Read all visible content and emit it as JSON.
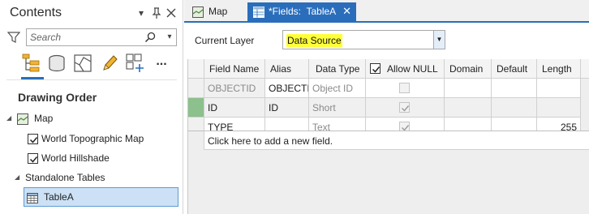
{
  "contents_pane": {
    "title": "Contents",
    "search_placeholder": "Search",
    "drawing_order_heading": "Drawing Order",
    "tree": {
      "map_label": "Map",
      "layers": [
        {
          "label": "World Topographic Map",
          "checked": true
        },
        {
          "label": "World Hillshade",
          "checked": true
        }
      ],
      "standalone_tables_label": "Standalone Tables",
      "tables": [
        {
          "label": "TableA",
          "selected": true
        }
      ]
    },
    "toolbar_more": "..."
  },
  "tabs": [
    {
      "label": "Map",
      "active": false
    },
    {
      "label": "*Fields:  TableA",
      "active": true
    }
  ],
  "fields_view": {
    "current_layer_label": "Current Layer",
    "current_layer_value": "Data Source",
    "columns": [
      "Field Name",
      "Alias",
      "Data Type",
      "Allow NULL",
      "Domain",
      "Default",
      "Length"
    ],
    "rows": [
      {
        "field_name": "OBJECTID",
        "alias": "OBJECTID",
        "data_type": "Object ID",
        "allow_null": false,
        "domain": "",
        "default": "",
        "length": ""
      },
      {
        "field_name": "ID",
        "alias": "ID",
        "data_type": "Short",
        "allow_null": true,
        "domain": "",
        "default": "",
        "length": ""
      },
      {
        "field_name": "TYPE",
        "alias": "",
        "data_type": "Text",
        "allow_null": true,
        "domain": "",
        "default": "",
        "length": "255"
      }
    ],
    "add_field_text": "Click here to add a new field."
  },
  "colors": {
    "accent": "#2a6ebb",
    "highlight": "#ffff3a",
    "row_marker": "#8cc08c",
    "selection": "#cce1f5"
  },
  "icons": {
    "pane_controls": [
      "chevron-down-icon",
      "pin-icon",
      "close-icon"
    ],
    "toolbar": [
      "list-by-drawing-order-icon",
      "list-by-source-icon",
      "list-by-selection-icon",
      "list-by-editing-icon",
      "list-by-snapping-icon",
      "more-icon"
    ]
  }
}
